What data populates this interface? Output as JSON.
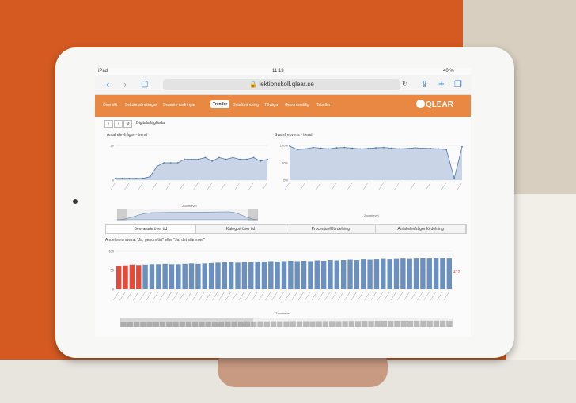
{
  "statusbar": {
    "device": "iPad",
    "time": "11:13",
    "battery": "40 %"
  },
  "safari": {
    "url": "lektionskoll.qlear.se"
  },
  "app_nav": {
    "tabs": [
      "Översikt",
      "Sektionsändringar",
      "Senaste ändringar",
      "Trender",
      "Dataförändring",
      "Tillväga",
      "Genomsnittlig",
      "Tabeller"
    ],
    "active_index": 3,
    "logo": "QLEAR"
  },
  "toolbar": {
    "title": "Digitala läglärda"
  },
  "chart_left_title": "Antal elevfrågor - trend",
  "chart_right_title": "Svarsfrekvens - trend",
  "navigator_label": "Zoomlevel",
  "subtabs": [
    "Besvarade över tid",
    "Kategori över tid",
    "Procentuell fördelning",
    "Antal elevfrågor fördelning"
  ],
  "subtabs_active_index": 0,
  "big_chart_title": "Andel som svarat \"Ja, genomfört\" eller \"Ja, det stämmer\"",
  "big_chart_side_label": "412",
  "colors": {
    "accent": "#e88842",
    "bar_blue": "#6b8fbf",
    "bar_red": "#e34a3a",
    "area_fill": "#c9d5e6",
    "line": "#4f77a8"
  },
  "chart_data": [
    {
      "type": "area",
      "title": "Antal elevfrågor - trend",
      "y_ticks": [
        "20",
        "0"
      ],
      "ylim": [
        0,
        20
      ],
      "values": [
        1,
        1,
        1,
        1,
        1,
        2,
        8,
        10,
        10,
        10,
        12,
        12,
        12,
        13,
        11,
        13,
        12,
        13,
        12,
        12,
        13,
        11,
        12
      ]
    },
    {
      "type": "area",
      "title": "Svarsfrekvens - trend",
      "y_ticks": [
        "100%",
        "50%",
        "0%"
      ],
      "ylim": [
        0,
        100
      ],
      "values": [
        98,
        88,
        90,
        94,
        92,
        90,
        93,
        94,
        92,
        90,
        91,
        93,
        94,
        92,
        90,
        91,
        93,
        92,
        91,
        90,
        88,
        5,
        96
      ]
    },
    {
      "type": "bar",
      "title": "Andel som svarat \"Ja, genomfört\" eller \"Ja, det stämmer\"",
      "y_ticks": [
        "100",
        "50",
        "0"
      ],
      "ylim": [
        0,
        100
      ],
      "values": [
        62,
        63,
        65,
        64,
        65,
        66,
        66,
        67,
        66,
        66,
        67,
        68,
        67,
        68,
        69,
        70,
        71,
        72,
        70,
        72,
        71,
        73,
        72,
        74,
        73,
        74,
        75,
        74,
        75,
        74,
        76,
        75,
        77,
        76,
        77,
        78,
        77,
        79,
        78,
        79,
        80,
        79,
        80,
        81,
        80,
        81,
        82,
        81,
        82,
        82,
        81
      ],
      "highlight_count": 4
    }
  ]
}
